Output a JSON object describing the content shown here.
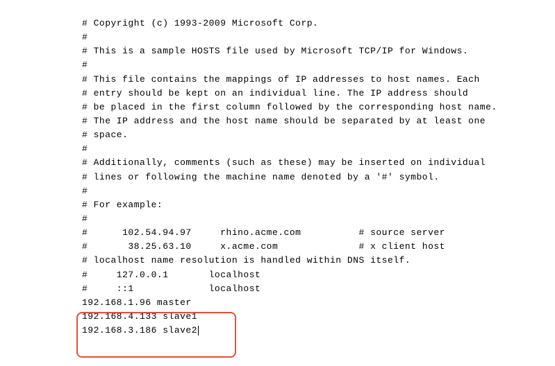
{
  "lines": {
    "l1": "# Copyright (c) 1993-2009 Microsoft Corp.",
    "l2": "#",
    "l3": "# This is a sample HOSTS file used by Microsoft TCP/IP for Windows.",
    "l4": "#",
    "l5": "# This file contains the mappings of IP addresses to host names. Each",
    "l6": "# entry should be kept on an individual line. The IP address should",
    "l7": "# be placed in the first column followed by the corresponding host name.",
    "l8": "# The IP address and the host name should be separated by at least one",
    "l9": "# space.",
    "l10": "#",
    "l11": "# Additionally, comments (such as these) may be inserted on individual",
    "l12": "# lines or following the machine name denoted by a '#' symbol.",
    "l13": "#",
    "l14": "# For example:",
    "l15": "#",
    "l16": "#      102.54.94.97     rhino.acme.com          # source server",
    "l17": "#       38.25.63.10     x.acme.com              # x client host",
    "l18": "",
    "l19": "# localhost name resolution is handled within DNS itself.",
    "l20": "#     127.0.0.1       localhost",
    "l21": "#     ::1             localhost",
    "l22": "192.168.1.96 master",
    "l23": "192.168.4.133 slave1",
    "l24": "192.168.3.186 slave2"
  },
  "host_entries": [
    {
      "ip": "192.168.1.96",
      "hostname": "master"
    },
    {
      "ip": "192.168.4.133",
      "hostname": "slave1"
    },
    {
      "ip": "192.168.3.186",
      "hostname": "slave2"
    }
  ]
}
